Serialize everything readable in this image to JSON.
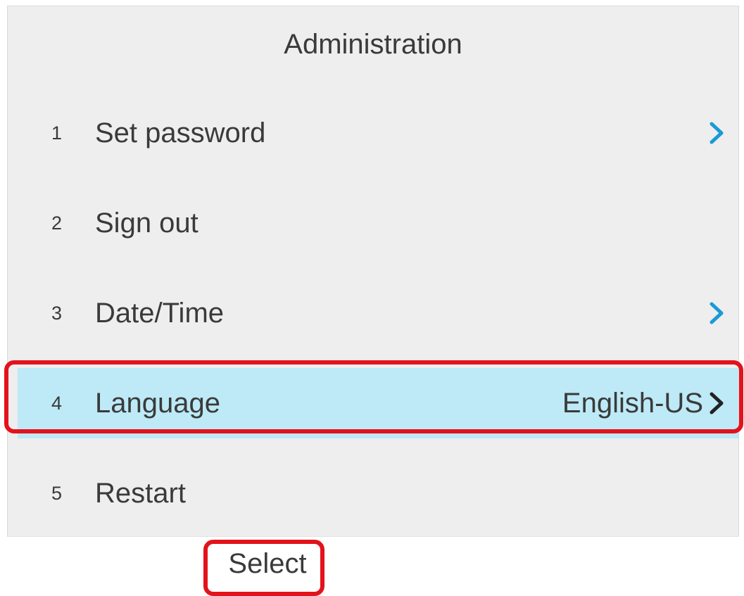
{
  "header": {
    "title": "Administration"
  },
  "menu": {
    "items": [
      {
        "number": "1",
        "label": "Set password",
        "value": "",
        "has_arrow": true,
        "arrow_color": "#1a9ad6",
        "selected": false
      },
      {
        "number": "2",
        "label": "Sign out",
        "value": "",
        "has_arrow": false,
        "selected": false
      },
      {
        "number": "3",
        "label": "Date/Time",
        "value": "",
        "has_arrow": true,
        "arrow_color": "#1a9ad6",
        "selected": false
      },
      {
        "number": "4",
        "label": "Language",
        "value": "English-US",
        "has_arrow": true,
        "arrow_color": "#222222",
        "selected": true
      },
      {
        "number": "5",
        "label": "Restart",
        "value": "",
        "has_arrow": false,
        "selected": false
      }
    ]
  },
  "softkeys": {
    "select_label": "Select"
  },
  "colors": {
    "highlight": "#bdeaf6",
    "accent_arrow": "#1a9ad6",
    "annotation_red": "#e3121b",
    "background": "#eeeeee"
  },
  "icons": {
    "arrow": "chevron-right-icon"
  }
}
